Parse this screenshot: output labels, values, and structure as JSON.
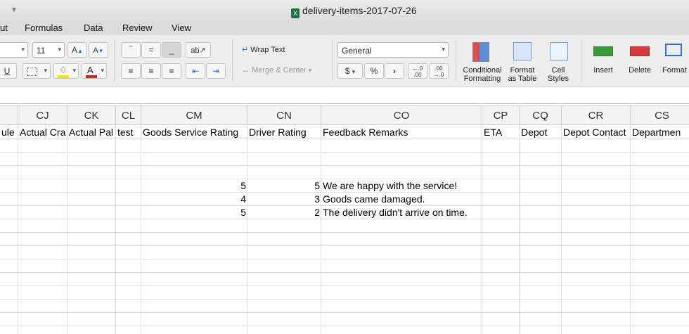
{
  "window": {
    "title": "delivery-items-2017-07-26"
  },
  "tabs": [
    "ut",
    "Formulas",
    "Data",
    "Review",
    "View"
  ],
  "ribbon": {
    "font_size": "11",
    "wrap_text": "Wrap Text",
    "merge_center": "Merge & Center",
    "number_format": "General",
    "currency": "$",
    "percent": "%",
    "comma": "›",
    "inc_decimal": "←.0 .00",
    "dec_decimal": ".00 →.0",
    "conditional_formatting": "Conditional Formatting",
    "format_as_table": "Format as Table",
    "cell_styles": "Cell Styles",
    "insert": "Insert",
    "delete": "Delete",
    "format": "Format",
    "accent_fill": "#f5e600",
    "accent_font": "#e02020"
  },
  "columns": [
    "",
    "CJ",
    "CK",
    "CL",
    "CM",
    "CN",
    "CO",
    "CP",
    "CQ",
    "CR",
    "CS"
  ],
  "header_row": [
    "ule",
    "Actual Cra",
    "Actual Pal",
    "test",
    "Goods Service Rating",
    "Driver Rating",
    "Feedback Remarks",
    "ETA",
    "Depot",
    "Depot Contact",
    "Departmen"
  ],
  "rows": [
    {
      "goods_rating": "5",
      "driver_rating": "5",
      "remarks": "We are happy with the service!"
    },
    {
      "goods_rating": "4",
      "driver_rating": "3",
      "remarks": "Goods came damaged."
    },
    {
      "goods_rating": "5",
      "driver_rating": "2",
      "remarks": "The delivery didn't arrive on time."
    }
  ]
}
